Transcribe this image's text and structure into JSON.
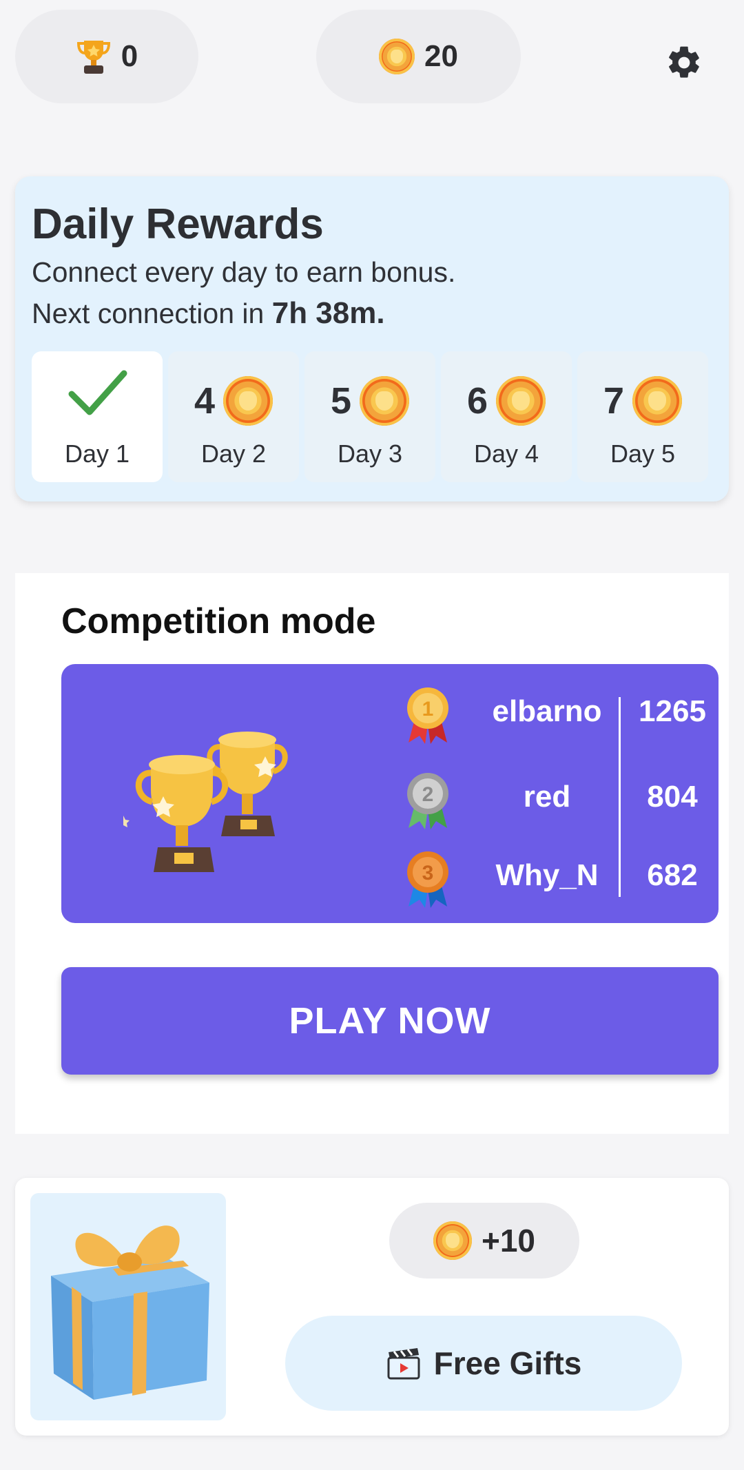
{
  "topbar": {
    "trophies": "0",
    "coins": "20",
    "icons": [
      "trophy-icon",
      "coin-icon",
      "gear-icon"
    ]
  },
  "daily_rewards": {
    "title": "Daily Rewards",
    "subtitle": "Connect every day to earn bonus.",
    "next_prefix": "Next connection in",
    "next_time": "7h 38m.",
    "days": [
      {
        "label": "Day 1",
        "amount": "",
        "claimed": true
      },
      {
        "label": "Day 2",
        "amount": "4",
        "claimed": false
      },
      {
        "label": "Day 3",
        "amount": "5",
        "claimed": false
      },
      {
        "label": "Day 4",
        "amount": "6",
        "claimed": false
      },
      {
        "label": "Day 5",
        "amount": "7",
        "claimed": false
      }
    ]
  },
  "competition": {
    "title": "Competition mode",
    "leaderboard": [
      {
        "rank": "1",
        "name": "elbarno",
        "score": "1265"
      },
      {
        "rank": "2",
        "name": "red",
        "score": "804"
      },
      {
        "rank": "3",
        "name": "Why_N",
        "score": "682"
      }
    ],
    "play_label": "PLAY NOW"
  },
  "gift": {
    "reward": "+10",
    "button_label": "Free Gifts",
    "icons": [
      "gift-box-icon",
      "clapperboard-icon"
    ]
  },
  "colors": {
    "accent": "#6c5ce7",
    "light_blue": "#e3f2fd",
    "check_green": "#43a047"
  }
}
